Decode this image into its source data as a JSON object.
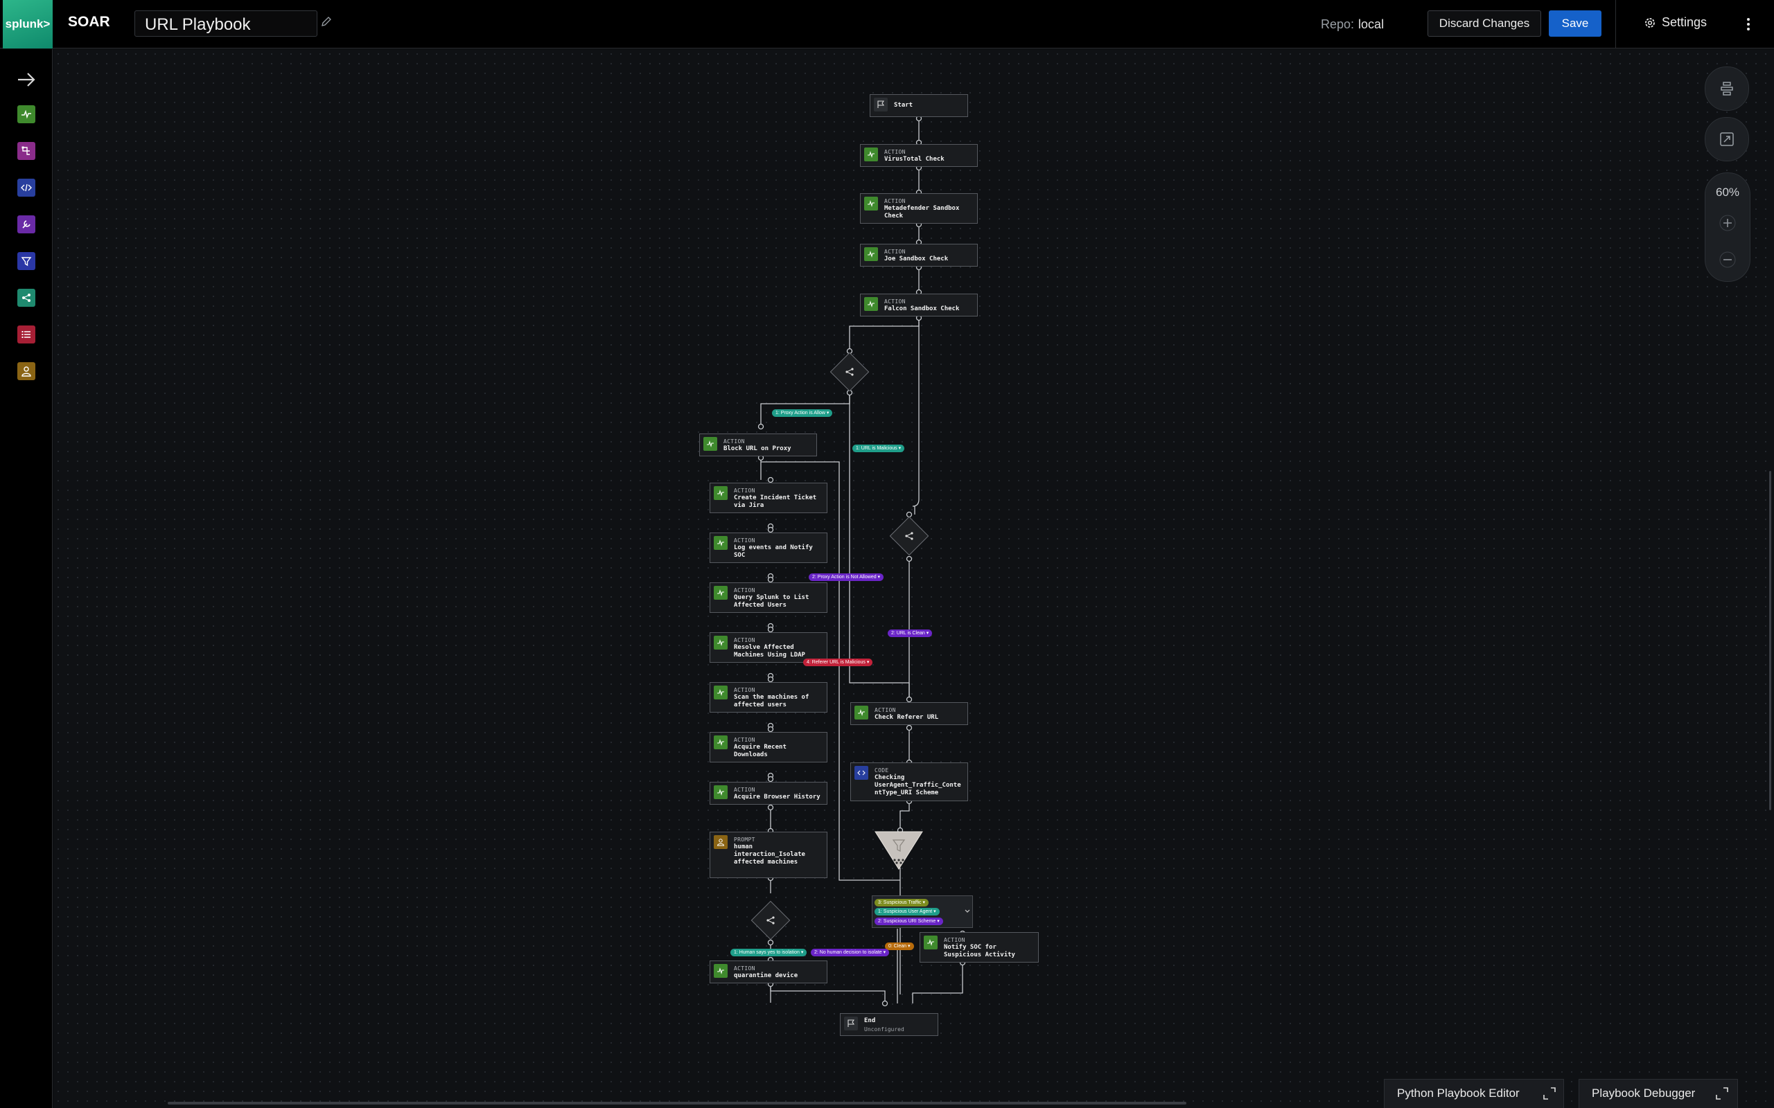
{
  "header": {
    "product": "SOAR",
    "logo_text": "splunk>",
    "playbook_title": "URL Playbook",
    "repo_label": "Repo:",
    "repo_value": "local",
    "discard_label": "Discard Changes",
    "save_label": "Save",
    "settings_label": "Settings"
  },
  "sidebar": {
    "items": [
      {
        "name": "action",
        "color": "#3f8a2d"
      },
      {
        "name": "decision",
        "color": "#8a2c8a"
      },
      {
        "name": "code",
        "color": "#283f9e"
      },
      {
        "name": "utility",
        "color": "#6a2aa6"
      },
      {
        "name": "filter",
        "color": "#2a37a6"
      },
      {
        "name": "format",
        "color": "#1f8a6f"
      },
      {
        "name": "list",
        "color": "#a61f35"
      },
      {
        "name": "prompt",
        "color": "#8a6414"
      }
    ]
  },
  "nodes": {
    "start": {
      "label": "Start"
    },
    "virustotal": {
      "type": "ACTION",
      "label": "VirusTotal Check"
    },
    "metadefender": {
      "type": "ACTION",
      "label": "Metadefender Sandbox\nCheck"
    },
    "joe": {
      "type": "ACTION",
      "label": "Joe Sandbox Check"
    },
    "falcon": {
      "type": "ACTION",
      "label": "Falcon Sandbox Check"
    },
    "block_url": {
      "type": "ACTION",
      "label": "Block URL on Proxy"
    },
    "jira": {
      "type": "ACTION",
      "label": "Create Incident Ticket\nvia Jira"
    },
    "log_events": {
      "type": "ACTION",
      "label": "Log events and Notify\nSOC"
    },
    "query_splunk": {
      "type": "ACTION",
      "label": "Query Splunk to List\nAffected Users"
    },
    "resolve_machines": {
      "type": "ACTION",
      "label": "Resolve Affected\nMachines Using LDAP"
    },
    "scan_machines": {
      "type": "ACTION",
      "label": "Scan the machines of\naffected users"
    },
    "recent_downloads": {
      "type": "ACTION",
      "label": "Acquire Recent\nDownloads"
    },
    "browser_history": {
      "type": "ACTION",
      "label": "Acquire Browser History"
    },
    "prompt": {
      "type": "PROMPT",
      "label": "human\ninteraction_Isolate\naffected machines"
    },
    "quarantine": {
      "type": "ACTION",
      "label": "quarantine device"
    },
    "check_referer": {
      "type": "ACTION",
      "label": "Check Referer URL"
    },
    "code": {
      "type": "CODE",
      "label": "Checking\nUserAgent_Traffic_Conte\nntType_URI Scheme"
    },
    "notify_soc": {
      "type": "ACTION",
      "label": "Notify SOC for\nSuspicious Activity"
    },
    "end": {
      "label": "End",
      "sub": "Unconfigured"
    }
  },
  "conditions": {
    "proxy_allow": "1: Proxy Action is Allow",
    "url_malicious": "1: URL is Malicious",
    "proxy_not_allowed": "2: Proxy Action is Not Allowed",
    "url_clean": "2: URL is Clean",
    "referer_malicious": "4: Referer URL is Malicious",
    "suspicious_traffic": "3: Suspicious Traffic",
    "suspicious_user_agent": "1: Suspicious User Agent",
    "suspicious_uri": "2: Suspicious URI Scheme",
    "clean": "0: Clean",
    "human_yes": "1: Human says yes to isolation",
    "human_no": "2: No human decision to isolate"
  },
  "canvas_controls": {
    "zoom_level": "60%"
  },
  "bottom_tabs": {
    "python_editor": "Python Playbook Editor",
    "debugger": "Playbook Debugger"
  }
}
